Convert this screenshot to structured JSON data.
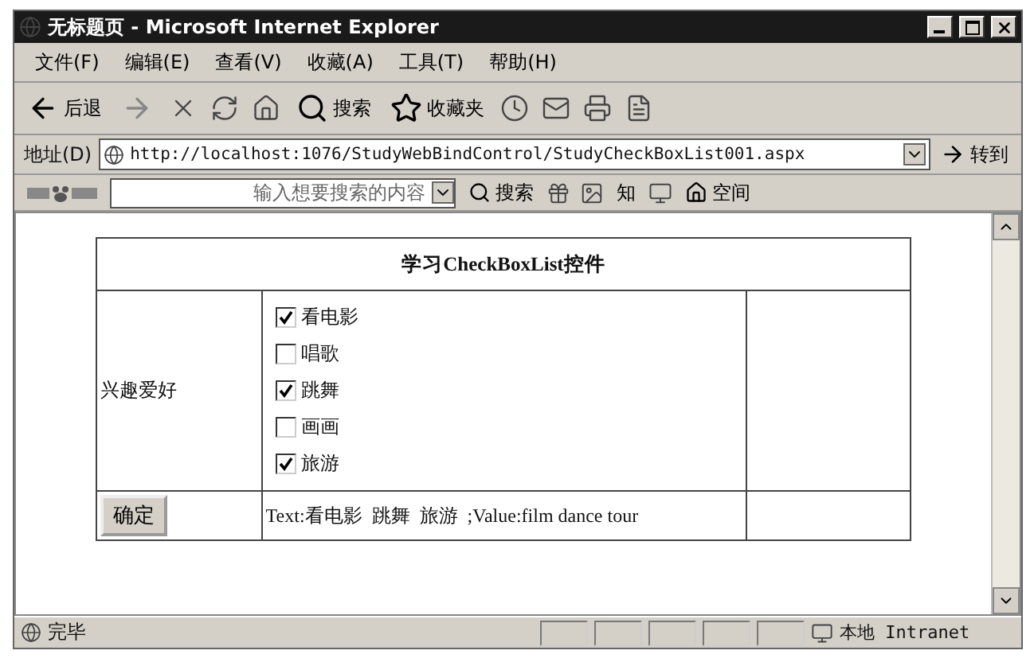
{
  "window": {
    "title": "无标题页 - Microsoft Internet Explorer"
  },
  "menu": [
    {
      "label": "文件(F)"
    },
    {
      "label": "编辑(E)"
    },
    {
      "label": "查看(V)"
    },
    {
      "label": "收藏(A)"
    },
    {
      "label": "工具(T)"
    },
    {
      "label": "帮助(H)"
    }
  ],
  "toolbar": {
    "back": "后退",
    "search": "搜索",
    "favorites": "收藏夹"
  },
  "address": {
    "label": "地址(D)",
    "url": "http://localhost:1076/StudyWebBindControl/StudyCheckBoxList001.aspx",
    "go": "转到"
  },
  "baidu_bar": {
    "search_placeholder": "输入想要搜索的内容",
    "search": "搜索",
    "knowledge": "知",
    "space": "空间"
  },
  "page": {
    "heading": "学习CheckBoxList控件",
    "field_label": "兴趣爱好",
    "options": [
      {
        "label": "看电影",
        "checked": true
      },
      {
        "label": "唱歌",
        "checked": false
      },
      {
        "label": "跳舞",
        "checked": true
      },
      {
        "label": "画画",
        "checked": false
      },
      {
        "label": "旅游",
        "checked": true
      }
    ],
    "submit": "确定",
    "result": "Text:看电影  跳舞  旅游  ;Value:film dance tour"
  },
  "status_bar": {
    "status": "完毕",
    "zone": "本地 Intranet"
  }
}
